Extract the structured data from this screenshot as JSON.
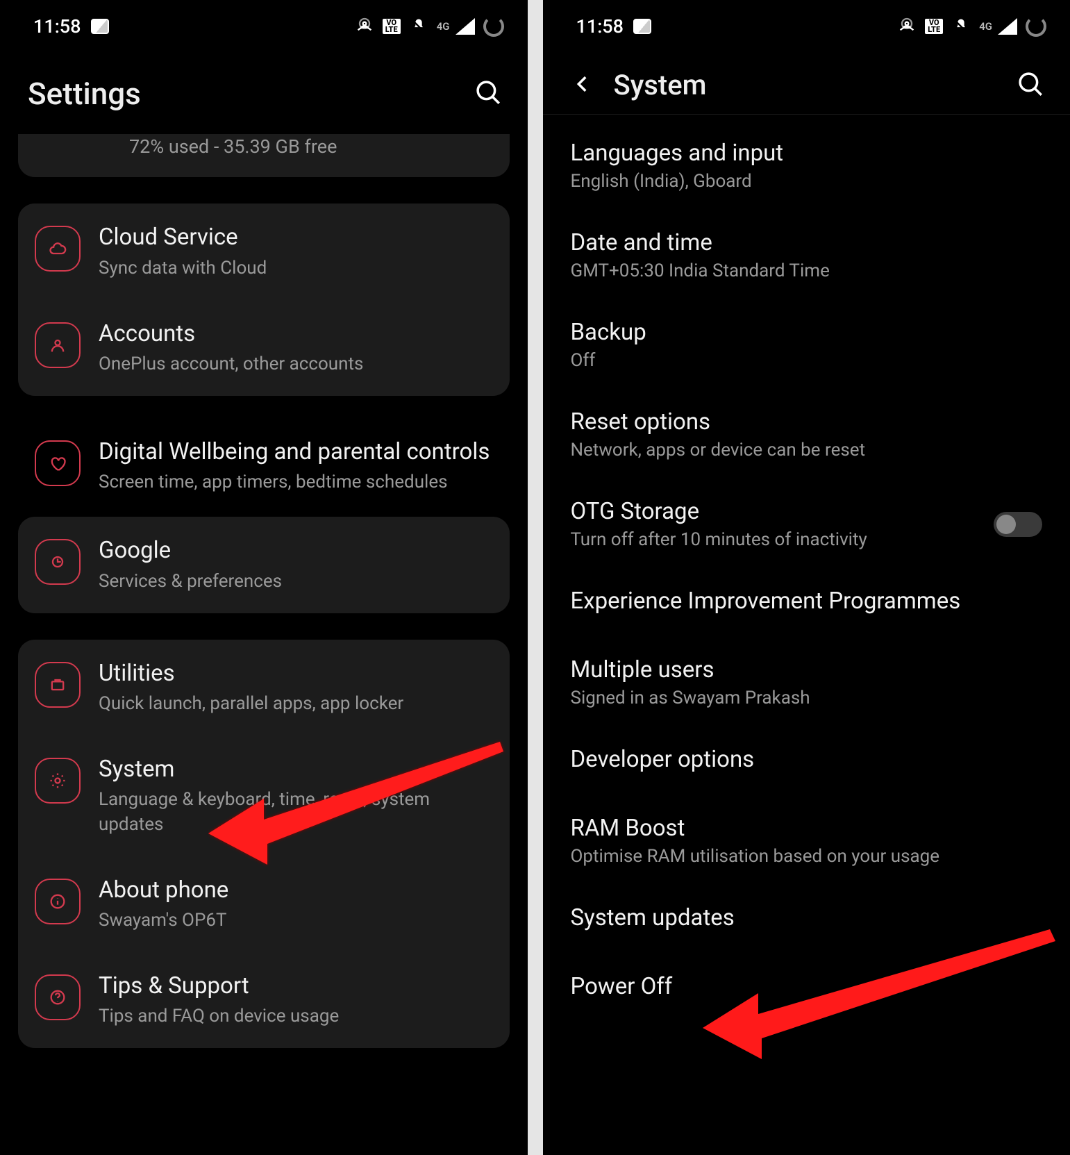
{
  "status": {
    "time": "11:58",
    "volte": "VO\nLTE",
    "network": "4G"
  },
  "left": {
    "header_title": "Settings",
    "storage_sub": "72% used - 35.39 GB free",
    "cloud": {
      "title": "Cloud Service",
      "sub": "Sync data with Cloud"
    },
    "accounts": {
      "title": "Accounts",
      "sub": "OnePlus account, other accounts"
    },
    "wellbeing": {
      "title": "Digital Wellbeing and parental controls",
      "sub": "Screen time, app timers, bedtime schedules"
    },
    "google": {
      "title": "Google",
      "sub": "Services & preferences"
    },
    "utilities": {
      "title": "Utilities",
      "sub": "Quick launch, parallel apps, app locker"
    },
    "system": {
      "title": "System",
      "sub": "Language & keyboard, time, reset, system updates"
    },
    "about": {
      "title": "About phone",
      "sub": "Swayam's OP6T"
    },
    "tips": {
      "title": "Tips & Support",
      "sub": "Tips and FAQ on device usage"
    }
  },
  "right": {
    "header_title": "System",
    "languages": {
      "title": "Languages and input",
      "sub": "English (India), Gboard"
    },
    "datetime": {
      "title": "Date and time",
      "sub": "GMT+05:30 India Standard Time"
    },
    "backup": {
      "title": "Backup",
      "sub": "Off"
    },
    "reset": {
      "title": "Reset options",
      "sub": "Network, apps or device can be reset"
    },
    "otg": {
      "title": "OTG Storage",
      "sub": "Turn off after 10 minutes of inactivity"
    },
    "experience": {
      "title": "Experience Improvement Programmes"
    },
    "multusers": {
      "title": "Multiple users",
      "sub": "Signed in as Swayam Prakash"
    },
    "developer": {
      "title": "Developer options"
    },
    "ramboost": {
      "title": "RAM Boost",
      "sub": "Optimise RAM utilisation based on your usage"
    },
    "sysupdates": {
      "title": "System updates"
    },
    "poweroff": {
      "title": "Power Off"
    }
  }
}
